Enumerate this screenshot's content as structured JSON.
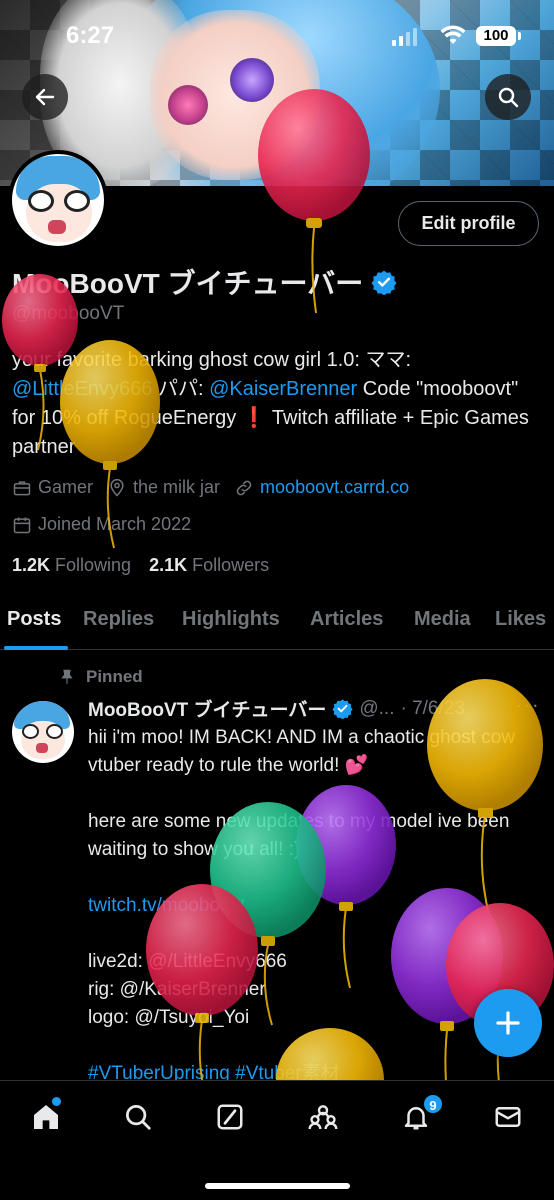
{
  "status_bar": {
    "time": "6:27",
    "battery": "100"
  },
  "profile": {
    "name": "MooBooVT ブイチューバー",
    "handle": "@moobooVT",
    "edit_label": "Edit profile",
    "bio": {
      "line1": "your favorite barking ghost cow girl 1.0: ママ:",
      "mention1": "@LittleEnvy666",
      "papa": " パパ: ",
      "mention2": "@KaiserBrenner",
      "code_text": " Code \"mooboovt\" for 10% off RogueEnergy ",
      "bang": "❗",
      "tail": " Twitch affiliate + Epic Games partner"
    },
    "category": "Gamer",
    "location": "the milk jar",
    "website": "mooboovt.carrd.co",
    "joined": "Joined March 2022",
    "following_count": "1.2K",
    "following_label": "Following",
    "followers_count": "2.1K",
    "followers_label": "Followers"
  },
  "tabs": [
    "Posts",
    "Replies",
    "Highlights",
    "Articles",
    "Media",
    "Likes"
  ],
  "tweet": {
    "pinned_label": "Pinned",
    "name": "MooBooVT ブイチューバー",
    "handle": "@...",
    "date": "· 7/6/23",
    "more": "···",
    "lines": [
      "hii i'm moo! IM BACK! AND IM a chaotic ghost cow vtuber ready to rule the world! 💕",
      "",
      "here are some new updates to my model ive been waiting to show you all! :)",
      "",
      "twitch.tv/mooboovt",
      "",
      "live2d: @/LittleEnvy666",
      "rig: @/KaiserBrenner",
      "logo: @/Tsuyoi_Yoi",
      "",
      "#VTuberUprising #Vtuber素材"
    ]
  },
  "nav": {
    "notifications_badge": "9"
  },
  "icons": {
    "back": "back-arrow-icon",
    "search": "search-icon",
    "verified": "verified-badge-icon",
    "briefcase": "briefcase-icon",
    "location": "location-pin-icon",
    "link": "link-icon",
    "calendar": "calendar-icon",
    "pin": "pin-icon",
    "compose": "plus-icon",
    "home": "home-icon",
    "explore": "search-icon",
    "grok": "grok-icon",
    "communities": "communities-icon",
    "notifications": "bell-icon",
    "messages": "mail-icon"
  },
  "colors": {
    "accent": "#1d9bf0",
    "muted": "#71767b",
    "text": "#e7e9ea",
    "background": "#000000"
  }
}
